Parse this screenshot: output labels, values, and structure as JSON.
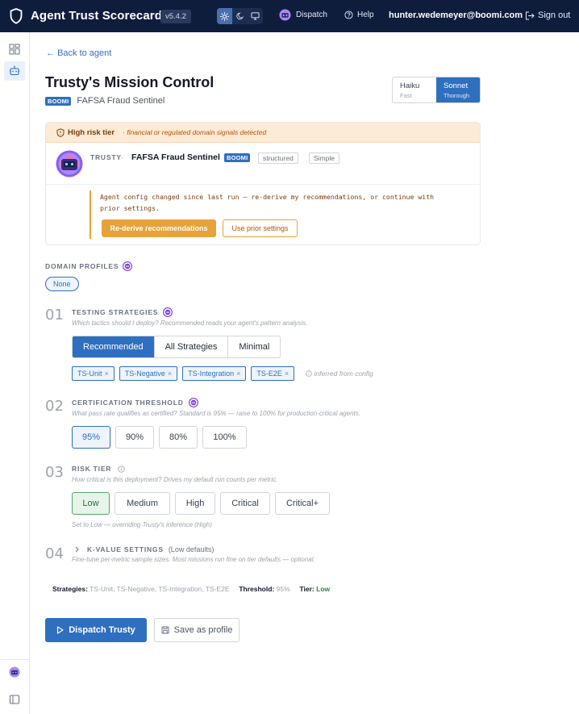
{
  "header": {
    "app_title": "Agent Trust Scorecard",
    "version": "v5.4.2",
    "dispatch_label": "Dispatch",
    "help_label": "Help",
    "user_email": "hunter.wedemeyer@boomi.com",
    "signout_label": "Sign out",
    "theme_options": [
      "light-icon",
      "dark-icon",
      "system-icon"
    ],
    "active_theme": "light-icon"
  },
  "rail": {
    "items": [
      "dashboard-icon",
      "robot-icon"
    ],
    "bottom": [
      "trusty-avatar-icon",
      "collapse-sidebar-icon"
    ]
  },
  "nav": {
    "back_label": "Back to agent"
  },
  "page": {
    "title": "Trusty's Mission Control",
    "platform_tag": "BOOMI",
    "agent_name": "FAFSA Fraud Sentinel"
  },
  "model_toggle": {
    "options": [
      {
        "name": "Haiku",
        "sub": "Fast",
        "active": false
      },
      {
        "name": "Sonnet",
        "sub": "Thorough",
        "active": true
      }
    ]
  },
  "agent_card": {
    "risk_title": "High risk tier",
    "risk_note": "· financial or regulated domain signals detected",
    "agent_kind": "TRUSTY",
    "separator": "·",
    "agent_name": "FAFSA Fraud Sentinel",
    "platform_tag": "BOOMI",
    "tags": [
      "structured",
      "Simple"
    ],
    "config_line1": "Agent config changed since last run — re-derive my recommendations, or continue with",
    "config_line2": "prior settings.",
    "rederive_label": "Re-derive recommendations",
    "prior_label": "Use prior settings"
  },
  "domain_profiles": {
    "label": "DOMAIN PROFILES",
    "selected": "None"
  },
  "testing": {
    "num": "01",
    "label": "TESTING STRATEGIES",
    "help": "Which tactics should I deploy? Recommended reads your agent's pattern analysis.",
    "modes": [
      "Recommended",
      "All Strategies",
      "Minimal"
    ],
    "active_mode": "Recommended",
    "chips": [
      "TS-Unit",
      "TS-Negative",
      "TS-Integration",
      "TS-E2E"
    ],
    "inferred": "inferred from config"
  },
  "threshold": {
    "num": "02",
    "label": "CERTIFICATION THRESHOLD",
    "help": "What pass rate qualifies as certified? Standard is 95% — raise to 100% for production-critical agents.",
    "options": [
      "95%",
      "90%",
      "80%",
      "100%"
    ],
    "selected": "95%"
  },
  "risk": {
    "num": "03",
    "label": "RISK TIER",
    "help": "How critical is this deployment? Drives my default run counts per metric.",
    "options": [
      "Low",
      "Medium",
      "High",
      "Critical",
      "Critical+"
    ],
    "selected": "Low",
    "override_note": "Set to Low — overriding Trusty's inference (High)"
  },
  "kvalue": {
    "num": "04",
    "label": "K-VALUE SETTINGS",
    "defaults": "(Low defaults)",
    "help": "Fine-tune per-metric sample sizes. Most missions run fine on tier defaults — optional."
  },
  "summary": {
    "strategies_label": "Strategies:",
    "strategies_value": "TS-Unit, TS-Negative, TS-Integration, TS-E2E",
    "threshold_label": "Threshold:",
    "threshold_value": "95%",
    "tier_label": "Tier:",
    "tier_value": "Low"
  },
  "actions": {
    "dispatch_label": "Dispatch Trusty",
    "save_label": "Save as profile"
  },
  "colors": {
    "brand_navy": "#0f1d3d",
    "accent_blue": "#2f6fc0",
    "warning_amber": "#e8a23a",
    "success_green": "#2f8a3e",
    "assist_purple": "#7c3aed"
  }
}
